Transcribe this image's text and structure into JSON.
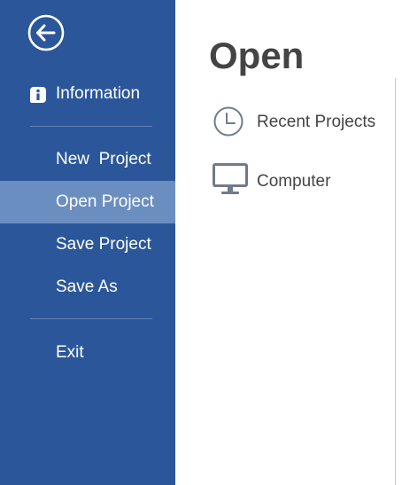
{
  "sidebar": {
    "back_icon": "back-arrow-circle-icon",
    "information": {
      "label": "Information",
      "icon": "info-icon"
    },
    "items": [
      {
        "label": "New  Project",
        "active": false
      },
      {
        "label": "Open Project",
        "active": true
      },
      {
        "label": "Save Project",
        "active": false
      },
      {
        "label": "Save As",
        "active": false
      },
      {
        "label": "Exit",
        "active": false
      }
    ]
  },
  "main": {
    "title": "Open",
    "locations": [
      {
        "label": "Recent Projects",
        "icon": "clock-icon"
      },
      {
        "label": "Computer",
        "icon": "computer-monitor-icon"
      }
    ]
  },
  "colors": {
    "sidebar_bg": "#2b579a",
    "active_item_bg": "#6b8ec0",
    "text_dark": "#444444",
    "icon_gray": "#6f7b8c"
  }
}
